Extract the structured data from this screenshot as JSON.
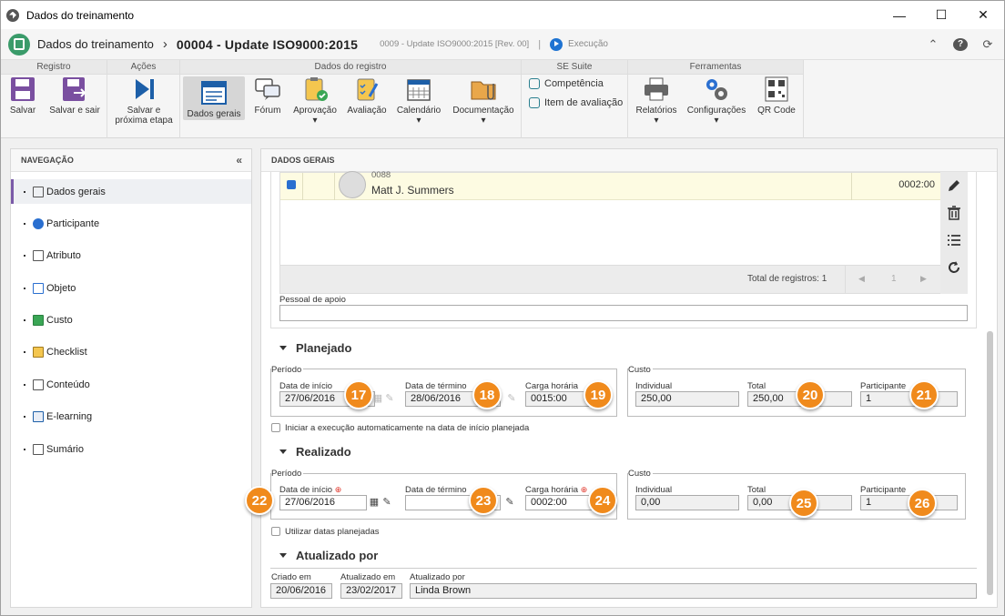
{
  "window": {
    "title": "Dados do treinamento",
    "minimize": "—",
    "maximize": "☐",
    "close": "✕"
  },
  "header": {
    "title": "Dados do treinamento",
    "separator": "›",
    "record": "00004 - Update ISO9000:2015",
    "revision": "0009 - Update ISO9000:2015 [Rev. 00]",
    "bar": "|",
    "status": "Execução"
  },
  "ribbon": {
    "groups": {
      "registro": "Registro",
      "acoes": "Ações",
      "dados": "Dados do registro",
      "suite": "SE Suite",
      "ferramentas": "Ferramentas"
    },
    "salvar": "Salvar",
    "salvar_sair": "Salvar e sair",
    "proxima_1": "Salvar e",
    "proxima_2": "próxima etapa",
    "dados_gerais": "Dados gerais",
    "forum": "Fórum",
    "aprovacao": "Aprovação",
    "avaliacao": "Avaliação",
    "calendario": "Calendário",
    "documentacao": "Documentação",
    "competencia": "Competência",
    "item_avaliacao": "Item de avaliação",
    "relatorios": "Relatórios",
    "configuracoes": "Configurações",
    "qrcode": "QR Code",
    "caret": "▾"
  },
  "nav": {
    "title": "NAVEGAÇÃO",
    "collapse": "«",
    "items": [
      {
        "label": "Dados gerais"
      },
      {
        "label": "Participante"
      },
      {
        "label": "Atributo"
      },
      {
        "label": "Objeto"
      },
      {
        "label": "Custo"
      },
      {
        "label": "Checklist"
      },
      {
        "label": "Conteúdo"
      },
      {
        "label": "E-learning"
      },
      {
        "label": "Sumário"
      }
    ]
  },
  "main": {
    "title": "DADOS GERAIS",
    "grid": {
      "row": {
        "code": "0088",
        "name": "Matt J. Summers",
        "hours": "0002:00"
      },
      "total": "Total de registros: 1",
      "page": "1",
      "prev": "◀",
      "next": "▶"
    },
    "pessoal_label": "Pessoal de apoio",
    "planejado": {
      "title": "Planejado",
      "periodo": "Período",
      "inicio_label": "Data de início",
      "inicio": "27/06/2016",
      "termino_label": "Data de término",
      "termino": "28/06/2016",
      "carga_label": "Carga horária",
      "carga": "0015:00",
      "custo": "Custo",
      "individual_label": "Individual",
      "individual": "250,00",
      "total_label": "Total",
      "total": "250,00",
      "participante_label": "Participante",
      "participante": "1",
      "auto_label": "Iniciar a execução automaticamente na data de início planejada"
    },
    "realizado": {
      "title": "Realizado",
      "periodo": "Período",
      "inicio_label": "Data de início",
      "inicio": "27/06/2016",
      "termino_label": "Data de término",
      "termino": "",
      "carga_label": "Carga horária",
      "carga": "0002:00",
      "custo": "Custo",
      "individual_label": "Individual",
      "individual": "0,00",
      "total_label": "Total",
      "total": "0,00",
      "participante_label": "Participante",
      "participante": "1",
      "usar_label": "Utilizar datas planejadas",
      "req": "⊕"
    },
    "atualizado": {
      "title": "Atualizado por",
      "criado_label": "Criado em",
      "criado": "20/06/2016",
      "atualizado_label": "Atualizado em",
      "atualizado": "23/02/2017",
      "por_label": "Atualizado por",
      "por": "Linda Brown"
    }
  },
  "badges": [
    "17",
    "18",
    "19",
    "20",
    "21",
    "22",
    "23",
    "24",
    "25",
    "26"
  ],
  "colors": {
    "accent": "#7a5aa8",
    "badge": "#f08a1c",
    "highlight_row": "#fdfbe2",
    "ribbon_icon": "#7a4fa0"
  }
}
